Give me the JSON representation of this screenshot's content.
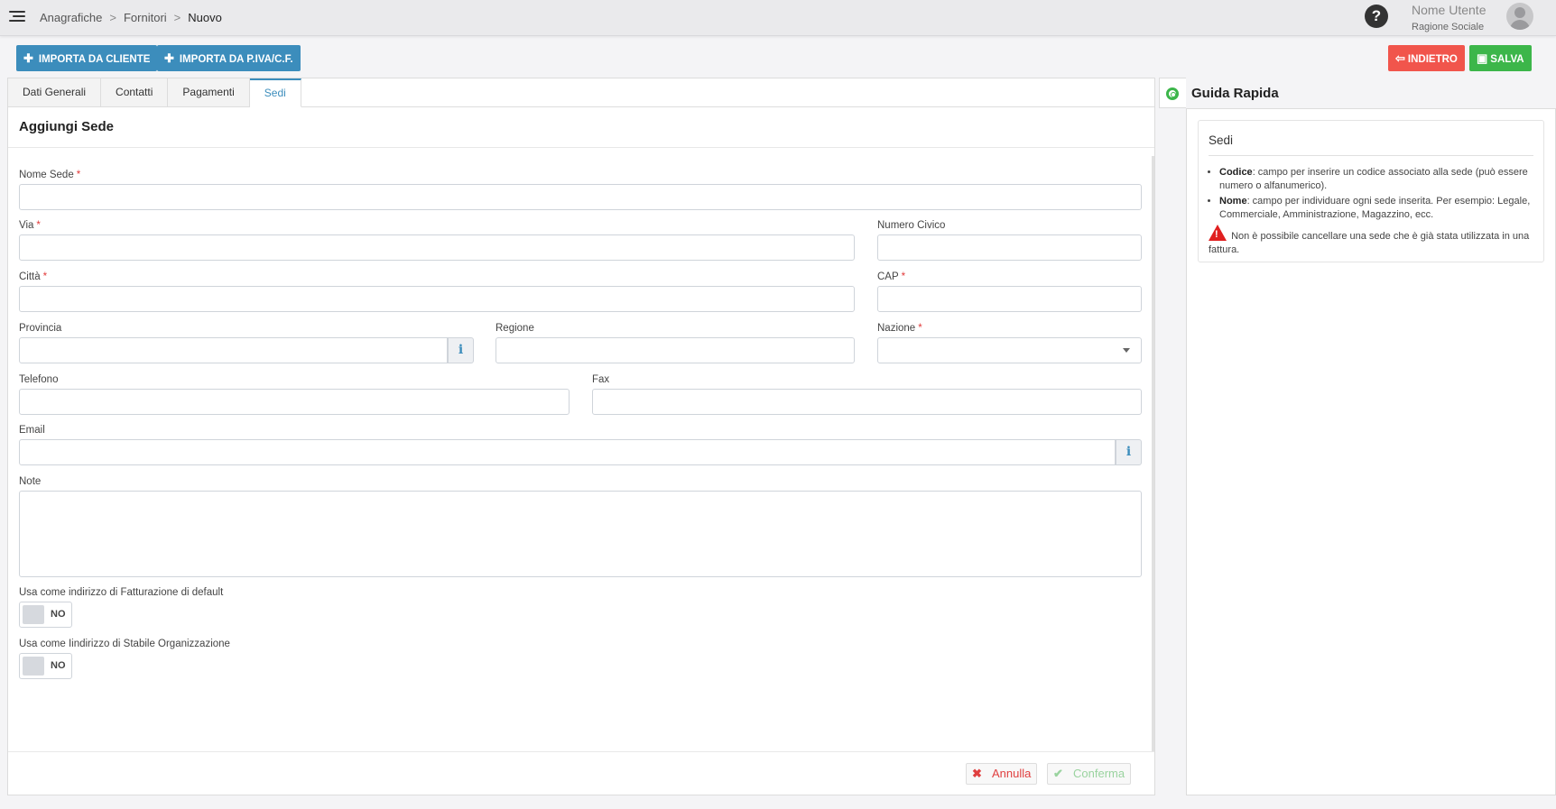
{
  "header": {
    "breadcrumb": [
      "Anagrafiche",
      "Fornitori",
      "Nuovo"
    ],
    "breadcrumb_sep": ">",
    "help_label": "?",
    "user_name": "Nome Utente",
    "user_company": "Ragione Sociale"
  },
  "toolbar": {
    "import_client": "IMPORTA DA CLIENTE",
    "import_piva": "IMPORTA DA P.IVA/C.F.",
    "back": "INDIETRO",
    "save": "SALVA"
  },
  "tabs": [
    {
      "label": "Dati Generali",
      "active": false
    },
    {
      "label": "Contatti",
      "active": false
    },
    {
      "label": "Pagamenti",
      "active": false
    },
    {
      "label": "Sedi",
      "active": true
    }
  ],
  "form": {
    "title": "Aggiungi Sede",
    "nome_sede": {
      "label": "Nome Sede",
      "required_mark": "*",
      "value": ""
    },
    "via": {
      "label": "Via",
      "required_mark": "*",
      "value": ""
    },
    "numero_civico": {
      "label": "Numero Civico",
      "value": ""
    },
    "citta": {
      "label": "Città",
      "required_mark": "*",
      "value": ""
    },
    "cap": {
      "label": "CAP",
      "required_mark": "*",
      "value": ""
    },
    "provincia": {
      "label": "Provincia",
      "value": "",
      "info": "i"
    },
    "regione": {
      "label": "Regione",
      "value": ""
    },
    "nazione": {
      "label": "Nazione",
      "required_mark": "*",
      "value": ""
    },
    "telefono": {
      "label": "Telefono",
      "value": ""
    },
    "fax": {
      "label": "Fax",
      "value": ""
    },
    "email": {
      "label": "Email",
      "value": "",
      "info": "i"
    },
    "note": {
      "label": "Note",
      "value": ""
    },
    "default_billing": {
      "label": "Usa come indirizzo di Fatturazione di default",
      "state": "NO"
    },
    "stable_org": {
      "label": "Usa come Iindirizzo di Stabile Organizzazione",
      "state": "NO"
    },
    "cancel": "Annulla",
    "confirm": "Conferma"
  },
  "guide": {
    "title": "Guida Rapida",
    "card_title": "Sedi",
    "items": [
      {
        "term": "Codice",
        "text": ": campo per inserire un codice associato alla sede (può essere numero o alfanumerico)."
      },
      {
        "term": "Nome",
        "text": ": campo per individuare ogni sede inserita. Per esempio: Legale, Commerciale, Amministrazione, Magazzino, ecc."
      }
    ],
    "warning": "Non è possibile cancellare una sede che è già stata utilizzata in una fattura."
  },
  "colors": {
    "primary": "#3c8dbc",
    "danger": "#f1554c",
    "success": "#3cb64a"
  }
}
